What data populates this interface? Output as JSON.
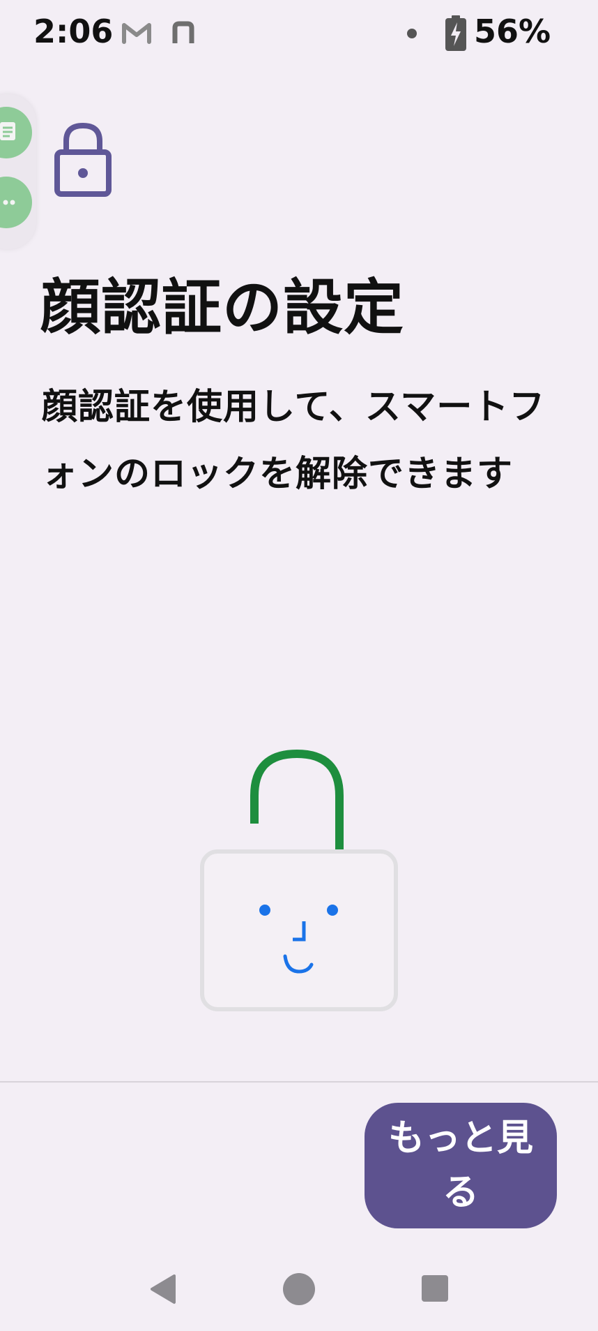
{
  "status_bar": {
    "time": "2:06",
    "battery_percent": "56%",
    "icons": [
      "gmail-icon",
      "notification-n-icon",
      "dot-icon",
      "battery-charging-icon"
    ]
  },
  "floating_bubbles": {
    "icons": [
      "message-bubble-icon",
      "more-bubble-icon"
    ],
    "color": "#8ecb98"
  },
  "header": {
    "icon": "lock-icon",
    "icon_color": "#5f5797"
  },
  "main": {
    "title": "顔認証の設定",
    "description": "顔認証を使用して、スマートフォンのロックを解除できます"
  },
  "illustration": {
    "icon": "face-unlock-illustration",
    "shackle_color": "#1e8e3e",
    "face_color": "#1a73e8",
    "frame_color": "#e0dfe2"
  },
  "footer": {
    "more_button_label": "もっと見る",
    "button_color": "#5d528f"
  },
  "nav_bar": {
    "icons": [
      "back-icon",
      "home-icon",
      "recents-icon"
    ]
  }
}
